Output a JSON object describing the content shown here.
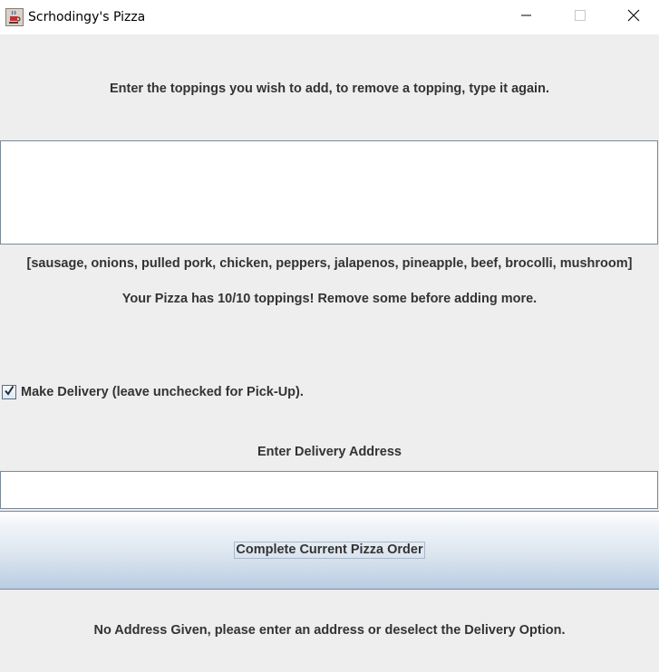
{
  "window": {
    "title": "Scrhodingy's Pizza",
    "icon": "java-cup-icon"
  },
  "toppings": {
    "instruction": "Enter the toppings you wish to add, to remove a topping, type it again.",
    "input_value": "",
    "list_text": "[sausage, onions, pulled pork, chicken, peppers, jalapenos, pineapple, beef, brocolli, mushroom]",
    "status_text": "Your Pizza has 10/10 toppings! Remove some before adding more."
  },
  "delivery": {
    "checkbox_label": "Make Delivery (leave unchecked for Pick-Up).",
    "checked": true,
    "address_label": "Enter Delivery Address",
    "address_value": ""
  },
  "order": {
    "button_label": "Complete Current Pizza Order",
    "message": "No Address Given, please enter an address or deselect the Delivery Option."
  }
}
